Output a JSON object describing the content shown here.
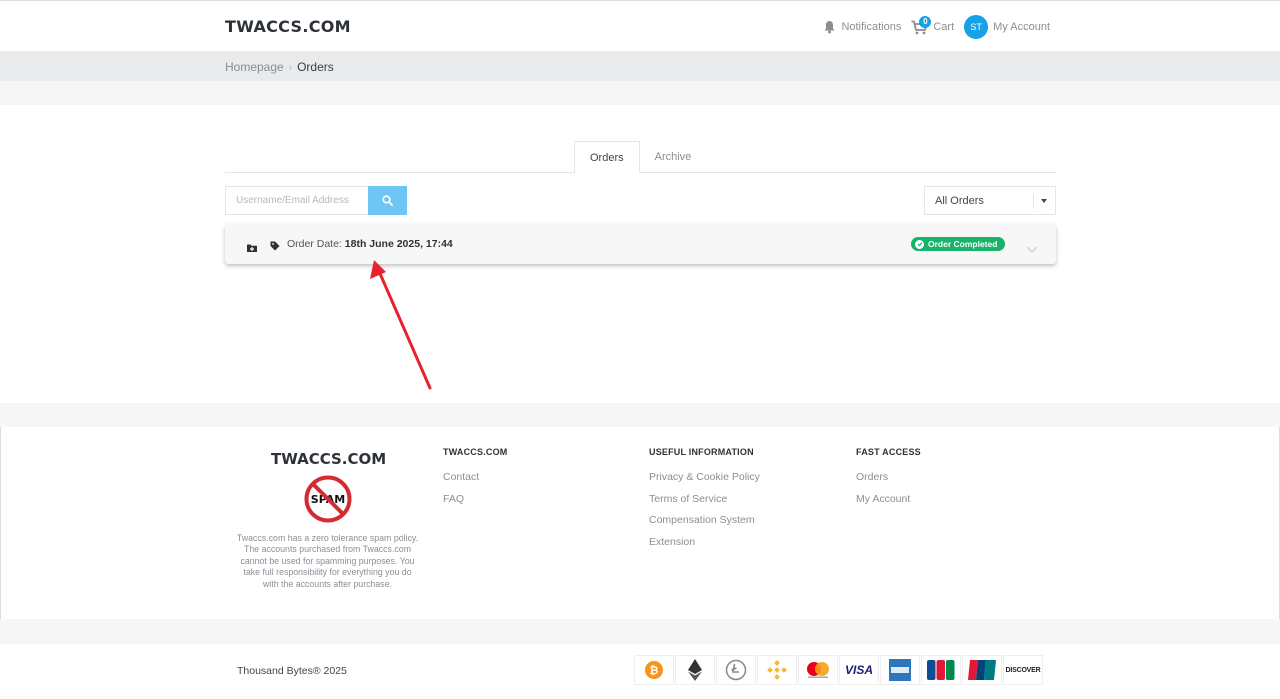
{
  "header": {
    "logo": "TWACCS.COM",
    "notifications_label": "Notifications",
    "cart_label": "Cart",
    "cart_count": "0",
    "avatar_initials": "ST",
    "account_label": "My Account"
  },
  "breadcrumb": {
    "home": "Homepage",
    "current": "Orders"
  },
  "tabs": [
    {
      "label": "Orders",
      "active": true
    },
    {
      "label": "Archive",
      "active": false
    }
  ],
  "search": {
    "placeholder": "Username/Email Address",
    "value": ""
  },
  "filter": {
    "selected": "All Orders"
  },
  "orders": [
    {
      "date_label": "Order Date:",
      "date_value": "18th June 2025, 17:44",
      "status": "Order Completed"
    }
  ],
  "footer": {
    "logo": "TWACCS.COM",
    "spam_text": "SPAM",
    "description": "Twaccs.com has a zero tolerance spam policy. The accounts purchased from Twaccs.com cannot be used for spamming purposes. You take full responsibility for everything you do with the accounts after purchase.",
    "columns": [
      {
        "title": "TWACCS.COM",
        "links": [
          "Contact",
          "FAQ"
        ]
      },
      {
        "title": "USEFUL INFORMATION",
        "links": [
          "Privacy & Cookie Policy",
          "Terms of Service",
          "Compensation System",
          "Extension"
        ]
      },
      {
        "title": "FAST ACCESS",
        "links": [
          "Orders",
          "My Account"
        ]
      }
    ],
    "copyright": "Thousand Bytes® 2025",
    "payment_icons": [
      "bitcoin-icon",
      "ethereum-icon",
      "litecoin-icon",
      "binance-icon",
      "mastercard-icon",
      "visa-icon",
      "amex-icon",
      "jcb-icon",
      "unionpay-icon",
      "discover-icon"
    ],
    "payment_labels": {
      "visa": "VISA",
      "discover": "DISCOVER"
    }
  },
  "colors": {
    "accent": "#18a0e8",
    "success": "#19b26b",
    "search_button": "#6ec6f7",
    "arrow": "#e8212e"
  }
}
